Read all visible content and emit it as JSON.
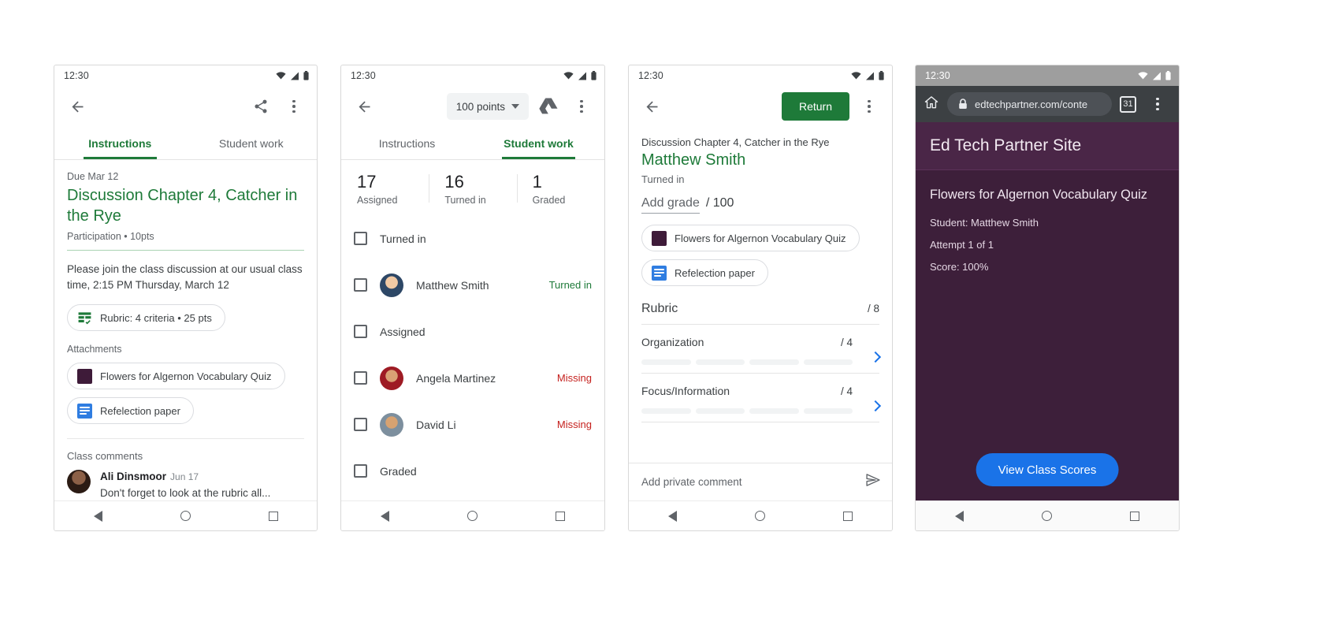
{
  "status_bar": {
    "time": "12:30",
    "icons": [
      "wifi-icon",
      "signal-icon",
      "battery-icon"
    ]
  },
  "colors": {
    "green": "#1e7a39",
    "red": "#c5221f",
    "blue": "#1a73e8",
    "purple_site": "#3d1f3a",
    "purple_header": "#4a2647",
    "attachment_swatch": "#3e1b39"
  },
  "phone1": {
    "appbar": {
      "back": "back-arrow-icon",
      "share": "share-icon",
      "overflow": "more-vert-icon"
    },
    "tabs": [
      {
        "label": "Instructions",
        "active": true
      },
      {
        "label": "Student work",
        "active": false
      }
    ],
    "due": "Due Mar 12",
    "title": "Discussion Chapter 4, Catcher in the Rye",
    "meta": "Participation • 10pts",
    "description": "Please join the class discussion at our usual class time, 2:15 PM Thursday, March 12",
    "rubric_chip": "Rubric: 4 criteria • 25 pts",
    "attachments_label": "Attachments",
    "attachments": [
      {
        "label": "Flowers for Algernon Vocabulary Quiz",
        "icon": "purple-swatch-icon"
      },
      {
        "label": "Refelection paper",
        "icon": "google-docs-icon"
      }
    ],
    "comments_label": "Class comments",
    "comment": {
      "author": "Ali Dinsmoor",
      "date": "Jun 17",
      "text": "Don't forget to look at the rubric all..."
    }
  },
  "phone2": {
    "appbar": {
      "back": "back-arrow-icon",
      "points": "100 points",
      "drive": "google-drive-icon",
      "overflow": "more-vert-icon"
    },
    "tabs": [
      {
        "label": "Instructions",
        "active": false
      },
      {
        "label": "Student work",
        "active": true
      }
    ],
    "stats": [
      {
        "num": "17",
        "label": "Assigned"
      },
      {
        "num": "16",
        "label": "Turned in"
      },
      {
        "num": "1",
        "label": "Graded"
      }
    ],
    "rows": [
      {
        "type": "group",
        "label": "Turned in"
      },
      {
        "type": "student",
        "name": "Matthew Smith",
        "status": "Turned in",
        "status_kind": "turned",
        "avatar": "avatar-matthew"
      },
      {
        "type": "group",
        "label": "Assigned"
      },
      {
        "type": "student",
        "name": "Angela Martinez",
        "status": "Missing",
        "status_kind": "missing",
        "avatar": "avatar-angela"
      },
      {
        "type": "student",
        "name": "David Li",
        "status": "Missing",
        "status_kind": "missing",
        "avatar": "avatar-david"
      },
      {
        "type": "group",
        "label": "Graded"
      }
    ]
  },
  "phone3": {
    "appbar": {
      "back": "back-arrow-icon",
      "return_label": "Return",
      "overflow": "more-vert-icon"
    },
    "assignment": "Discussion Chapter 4, Catcher in the Rye",
    "student": "Matthew Smith",
    "state": "Turned in",
    "grade_placeholder": "Add grade",
    "grade_total": "/ 100",
    "attachments": [
      {
        "label": "Flowers for Algernon Vocabulary Quiz",
        "icon": "purple-swatch-icon"
      },
      {
        "label": "Refelection paper",
        "icon": "google-docs-icon"
      }
    ],
    "rubric": {
      "title": "Rubric",
      "total": "/ 8",
      "criteria": [
        {
          "name": "Organization",
          "score": "/ 4",
          "levels": 4
        },
        {
          "name": "Focus/Information",
          "score": "/ 4",
          "levels": 4
        }
      ]
    },
    "private_comment_placeholder": "Add private comment",
    "send_icon": "send-icon"
  },
  "phone4": {
    "browser": {
      "home_icon": "home-icon",
      "lock_icon": "lock-icon",
      "url": "edtechpartner.com/conte",
      "tab_count": "31",
      "overflow": "more-vert-icon"
    },
    "site_title": "Ed Tech Partner Site",
    "page_title": "Flowers for Algernon Vocabulary Quiz",
    "lines": [
      "Student: Matthew Smith",
      "Attempt 1 of 1",
      "Score: 100%"
    ],
    "cta": "View Class Scores"
  },
  "navbar": {
    "back": "nav-back-icon",
    "home": "nav-home-icon",
    "recents": "nav-recents-icon"
  }
}
